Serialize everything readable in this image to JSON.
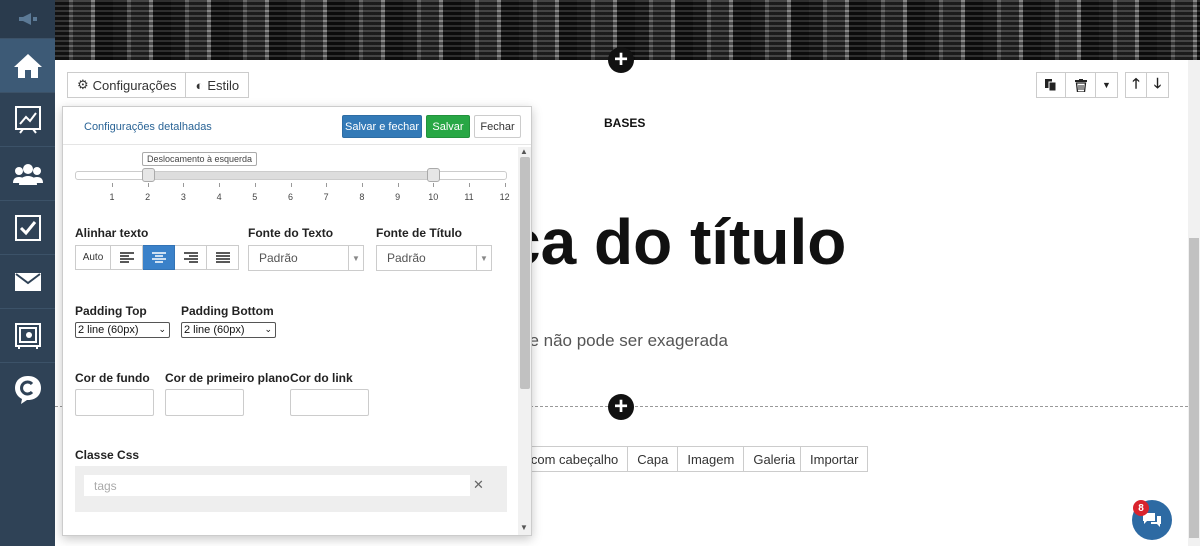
{
  "toolbar": {
    "config_label": "Configurações",
    "style_label": "Estilo"
  },
  "canvas": {
    "section_label": "BASES",
    "big_title": "ça do título",
    "subtitle": "ue não pode ser exagerada"
  },
  "block_types": [
    "o com cabeçalho",
    "Capa",
    "Imagem",
    "Galeria"
  ],
  "import_label": "Importar",
  "chat": {
    "badge_count": "8"
  },
  "panel": {
    "title": "Configurações detalhadas",
    "save_close_label": "Salvar e fechar",
    "save_label": "Salvar",
    "close_label": "Fechar",
    "slider": {
      "tooltip": "Deslocamento à esquerda",
      "ticks": [
        "1",
        "2",
        "3",
        "4",
        "5",
        "6",
        "7",
        "8",
        "9",
        "10",
        "11",
        "12"
      ],
      "left_value": 2,
      "right_value": 10,
      "min": 0,
      "max": 12
    },
    "align_label": "Alinhar texto",
    "align_auto": "Auto",
    "font_text_label": "Fonte do Texto",
    "font_text_value": "Padrão",
    "font_title_label": "Fonte de Título",
    "font_title_value": "Padrão",
    "padding_top_label": "Padding Top",
    "padding_top_value": "2 line (60px)",
    "padding_bottom_label": "Padding Bottom",
    "padding_bottom_value": "2 line (60px)",
    "bg_color_label": "Cor de fundo",
    "fg_color_label": "Cor de primeiro plano",
    "link_color_label": "Cor do link",
    "css_class_label": "Classe Css",
    "tags_placeholder": "tags"
  },
  "colors": {
    "sidebar": "#2f4256",
    "primary": "#337ab7",
    "success": "#28a745",
    "active_align": "#3a81c9",
    "chat": "#2d6aa3",
    "badge": "#d9232d"
  },
  "icons": {
    "sidebar": [
      "megaphone-icon",
      "home-icon",
      "chart-icon",
      "users-icon",
      "checkbox-icon",
      "mail-icon",
      "safe-icon",
      "chat-c-icon"
    ]
  }
}
